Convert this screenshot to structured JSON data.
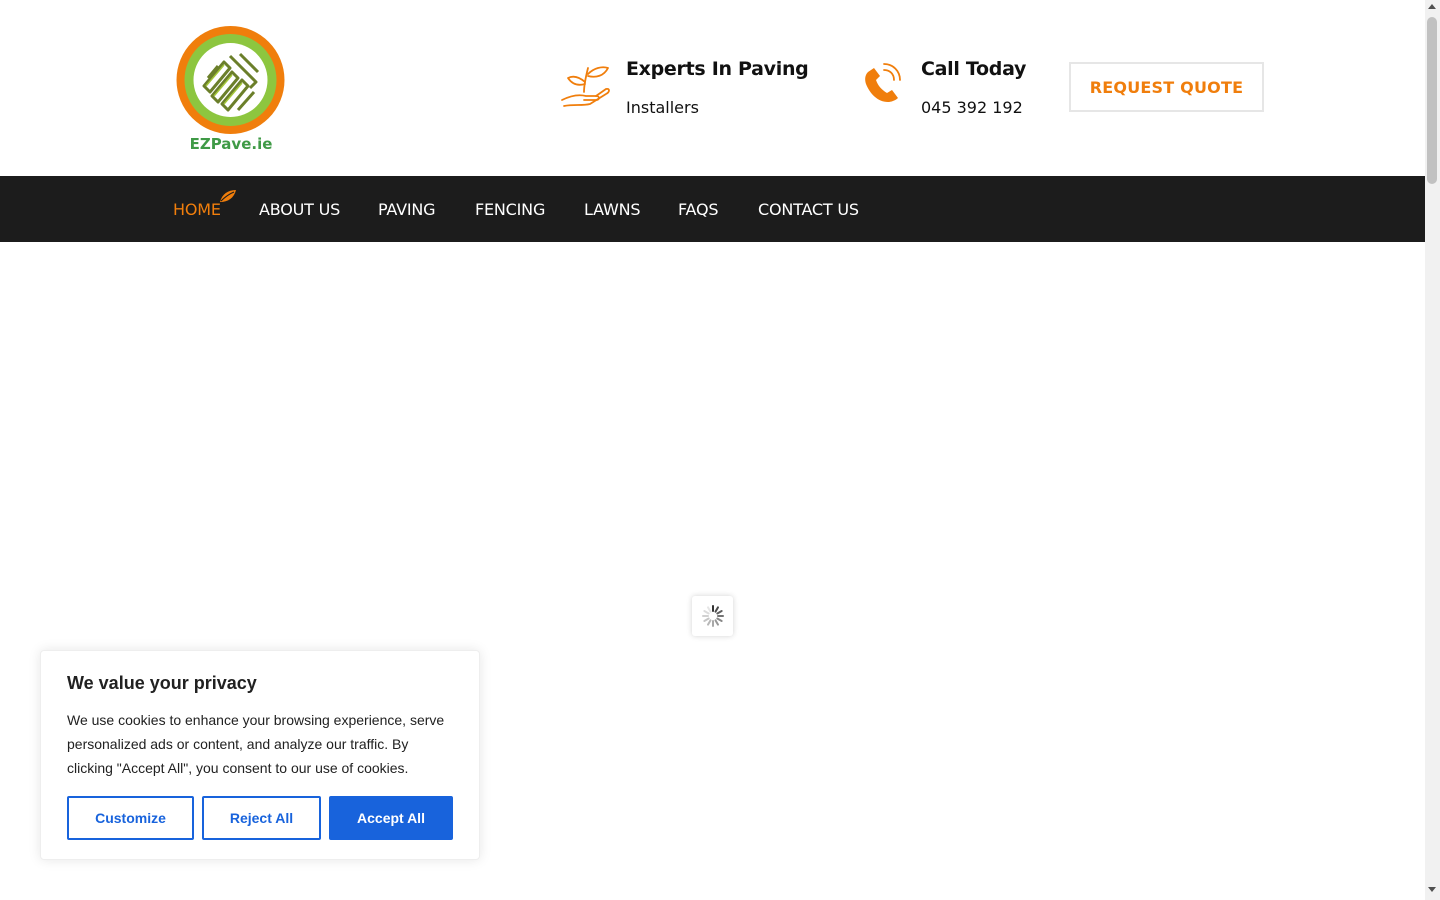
{
  "header": {
    "logo_text": "EZPave.ie",
    "experts": {
      "title": "Experts In Paving",
      "subtitle": "Installers",
      "icon": "plant-hand-icon"
    },
    "call": {
      "title": "Call Today",
      "phone": "045 392 192",
      "icon": "phone-icon"
    },
    "quote_button": "REQUEST QUOTE"
  },
  "nav": {
    "items": [
      {
        "label": "HOME",
        "active": true
      },
      {
        "label": "ABOUT US"
      },
      {
        "label": "PAVING"
      },
      {
        "label": "FENCING"
      },
      {
        "label": "LAWNS"
      },
      {
        "label": "FAQS"
      },
      {
        "label": "CONTACT US"
      }
    ]
  },
  "cookie": {
    "title": "We value your privacy",
    "text": "We use cookies to enhance your browsing experience, serve personalized ads or content, and analyze our traffic. By clicking \"Accept All\", you consent to our use of cookies.",
    "customize": "Customize",
    "reject": "Reject All",
    "accept": "Accept All"
  },
  "colors": {
    "accent": "#f07e0c",
    "nav_bg": "#1c1c1c",
    "cookie_blue": "#1863dc",
    "logo_green": "#8dc63f"
  }
}
